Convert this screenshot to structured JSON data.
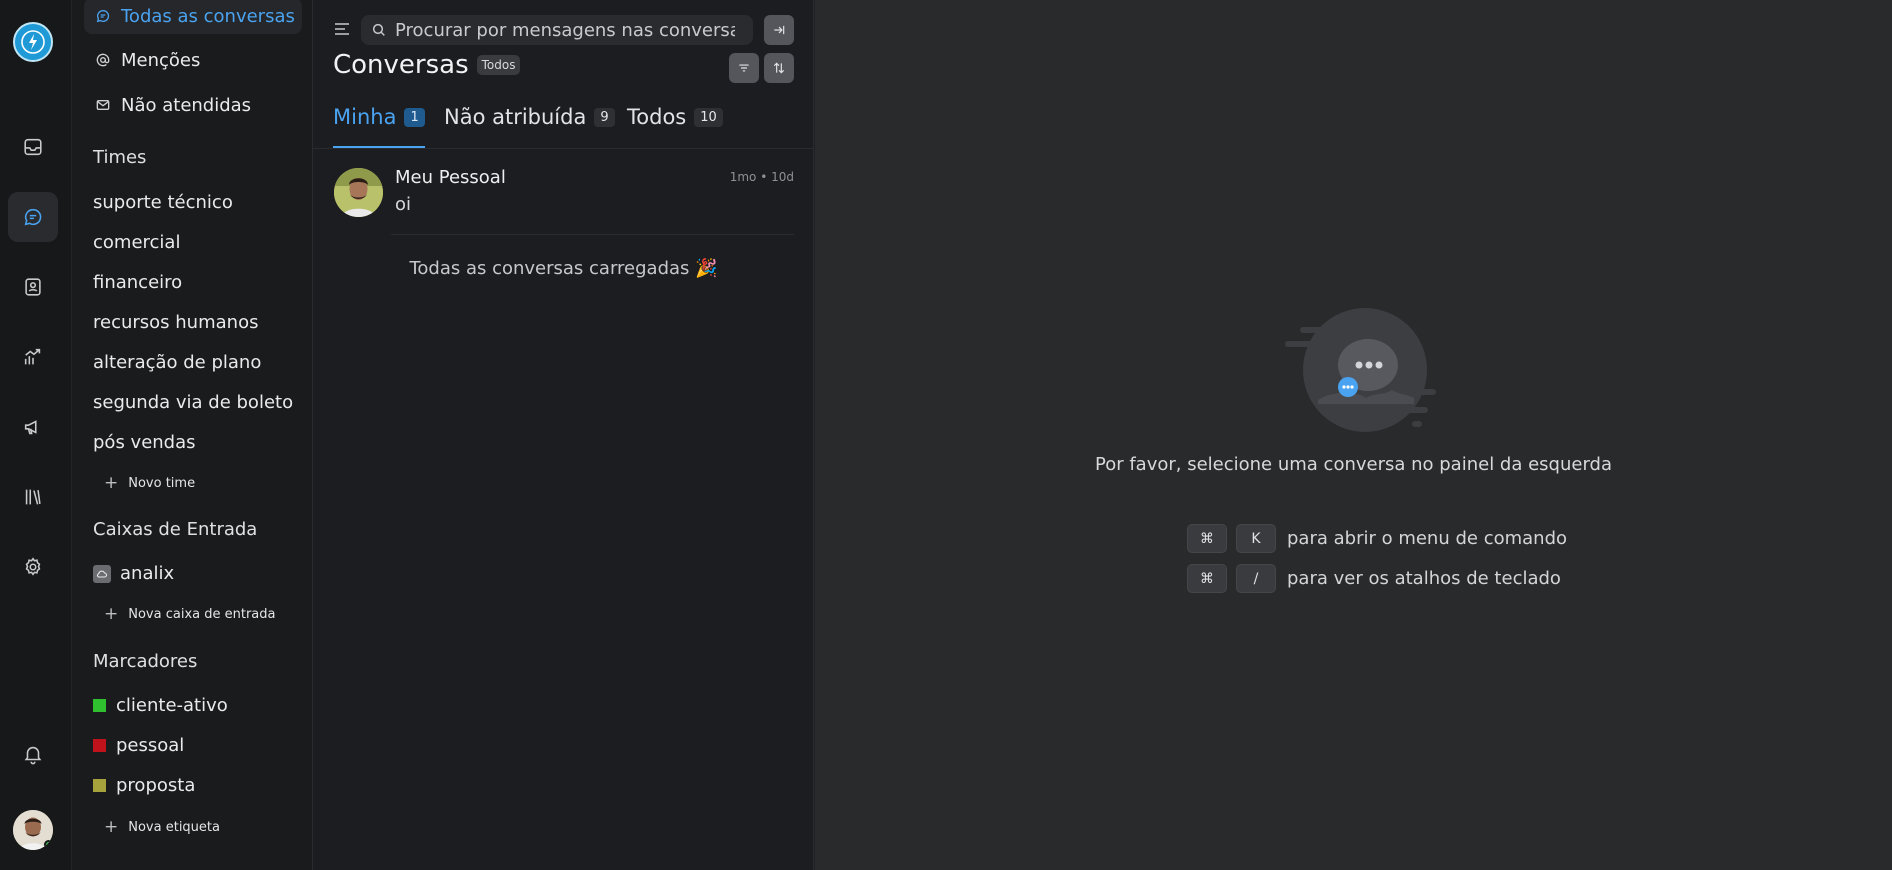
{
  "rail": {
    "items": [
      {
        "name": "inbox-icon"
      },
      {
        "name": "conversations-icon",
        "active": true
      },
      {
        "name": "contacts-icon"
      },
      {
        "name": "reports-icon"
      },
      {
        "name": "campaigns-icon"
      },
      {
        "name": "library-icon"
      },
      {
        "name": "settings-icon"
      }
    ],
    "notifications_icon": "bell-icon"
  },
  "sidebar": {
    "nav": [
      {
        "label": "Todas as conversas",
        "icon": "chat-icon",
        "active": true
      },
      {
        "label": "Menções",
        "icon": "at-icon"
      },
      {
        "label": "Não atendidas",
        "icon": "mail-icon"
      }
    ],
    "teams_heading": "Times",
    "teams": [
      "suporte técnico",
      "comercial",
      "financeiro",
      "recursos humanos",
      "alteração de plano",
      "segunda via de boleto",
      "pós vendas"
    ],
    "new_team": "Novo time",
    "inboxes_heading": "Caixas de Entrada",
    "inboxes": [
      "analix"
    ],
    "new_inbox": "Nova caixa de entrada",
    "labels_heading": "Marcadores",
    "labels": [
      {
        "name": "cliente-ativo",
        "color": "#2fbf2f"
      },
      {
        "name": "pessoal",
        "color": "#c0121b"
      },
      {
        "name": "proposta",
        "color": "#a6a23c"
      }
    ],
    "new_label": "Nova etiqueta"
  },
  "list": {
    "search_placeholder": "Procurar por mensagens nas conversas",
    "title": "Conversas",
    "filter_pill": "Todos",
    "tabs": [
      {
        "label": "Minha",
        "count": "1",
        "active": true
      },
      {
        "label": "Não atribuída",
        "count": "9"
      },
      {
        "label": "Todos",
        "count": "10"
      }
    ],
    "conversations": [
      {
        "name": "Meu Pessoal",
        "message": "oi",
        "time": "1mo • 10d"
      }
    ],
    "all_loaded": "Todas as conversas carregadas 🎉"
  },
  "main": {
    "empty_message": "Por favor, selecione uma conversa no painel da esquerda",
    "shortcuts": [
      {
        "keys": [
          "⌘",
          "K"
        ],
        "text": "para abrir o menu de comando"
      },
      {
        "keys": [
          "⌘",
          "/"
        ],
        "text": "para ver os atalhos de teclado"
      }
    ]
  },
  "colors": {
    "accent": "#4aa3f0"
  }
}
